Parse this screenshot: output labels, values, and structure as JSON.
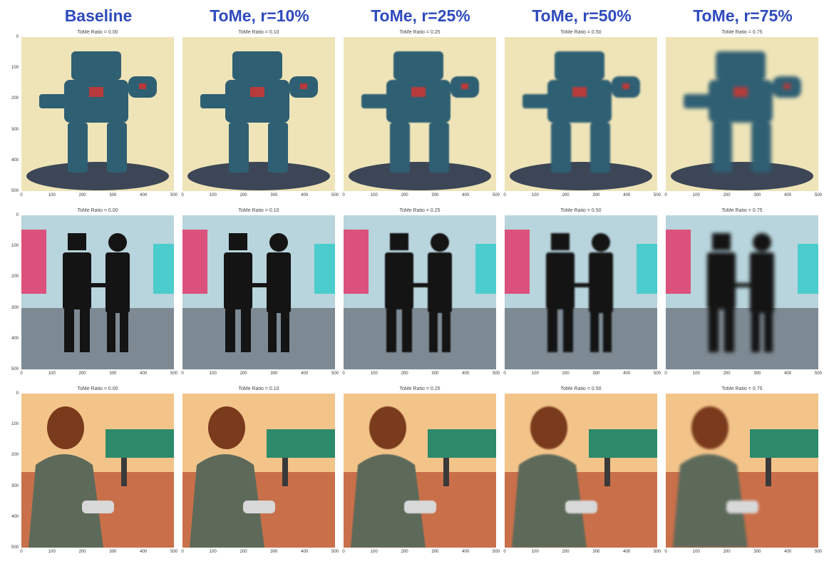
{
  "columns": [
    {
      "label": "Baseline",
      "ratio_title": "ToMe Ratio = 0.00"
    },
    {
      "label": "ToMe, r=10%",
      "ratio_title": "ToMe Ratio = 0.10"
    },
    {
      "label": "ToMe, r=25%",
      "ratio_title": "ToMe Ratio = 0.25"
    },
    {
      "label": "ToMe, r=50%",
      "ratio_title": "ToMe Ratio = 0.50"
    },
    {
      "label": "ToMe, r=75%",
      "ratio_title": "ToMe Ratio = 0.75"
    }
  ],
  "y_ticks": [
    "0",
    "100",
    "200",
    "300",
    "400",
    "500"
  ],
  "x_ticks": [
    "0",
    "100",
    "200",
    "300",
    "400",
    "500"
  ],
  "rows": [
    {
      "subject": "toy robot on a stand",
      "colors": {
        "bg": "#efe4b8",
        "main": "#2f5f73",
        "accent": "#b83a3a",
        "base": "#3c4656"
      }
    },
    {
      "subject": "two robots walking holding hands in a neon city street",
      "colors": {
        "bg": "#b8d4dc",
        "main": "#141414",
        "accent": "#e23a6a",
        "base": "#7e8a93"
      }
    },
    {
      "subject": "girl holding a bottle at a gas station in sunlight",
      "colors": {
        "bg": "#f3c48a",
        "main": "#7a3a1c",
        "accent": "#2d8a6a",
        "base": "#c9704a"
      }
    }
  ]
}
